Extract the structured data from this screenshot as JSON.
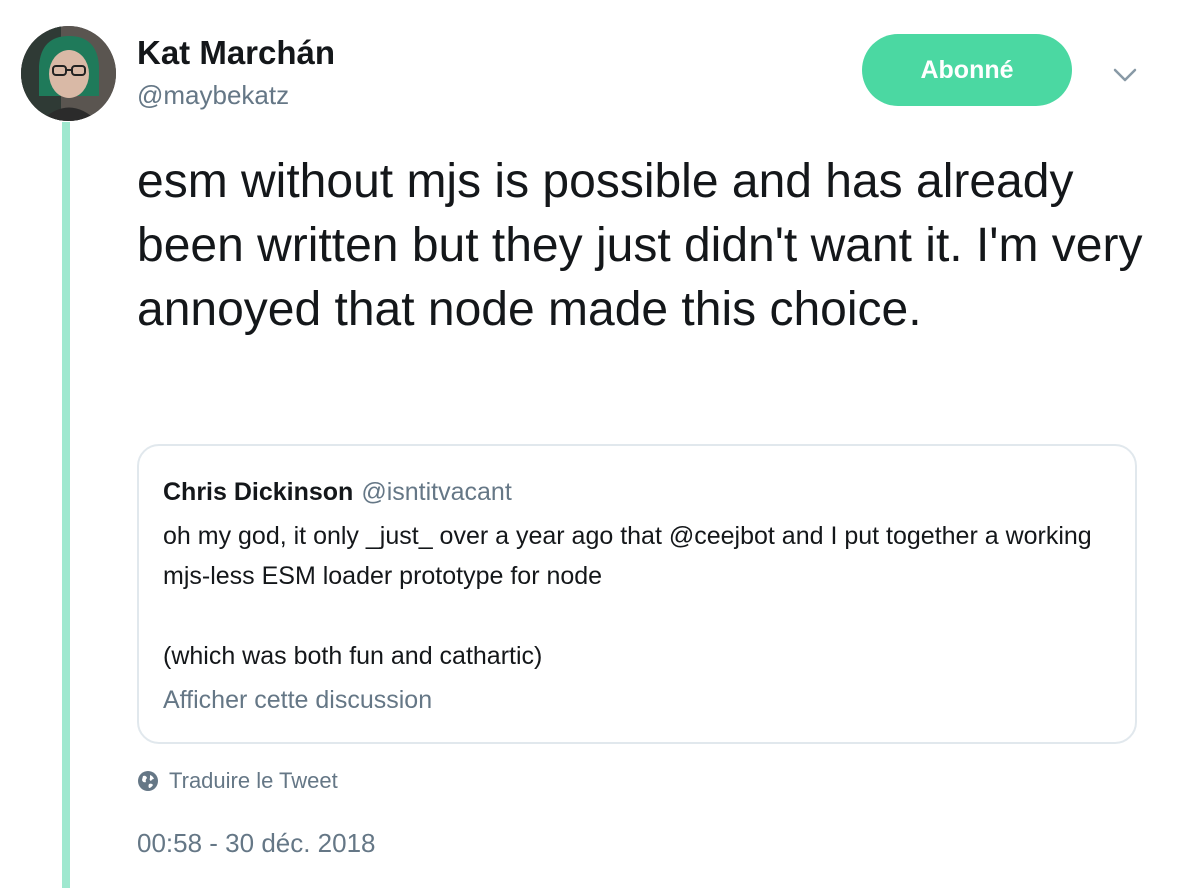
{
  "author": {
    "display_name": "Kat Marchán",
    "handle": "@maybekatz",
    "avatar_icon": "profile-photo"
  },
  "follow_button": {
    "label": "Abonné",
    "color": "#4bd8a2"
  },
  "menu": {
    "icon": "chevron-down-icon"
  },
  "tweet": {
    "text": "esm without mjs is possible and has already been written but they just didn't want it. I'm very annoyed that node made this choice."
  },
  "quoted_tweet": {
    "author_name": "Chris Dickinson",
    "author_handle": "@isntitvacant",
    "paragraphs": [
      "oh my god, it only _just_ over a year ago that @ceejbot and I put together a working mjs-less ESM loader prototype for node",
      "(which was both fun and cathartic)"
    ],
    "show_thread_label": "Afficher cette discussion"
  },
  "translate": {
    "label": "Traduire le Tweet",
    "icon": "globe-icon"
  },
  "timestamp": "00:58 - 30 déc. 2018",
  "colors": {
    "accent": "#4bd8a2",
    "thread_line": "#9fe8cf",
    "secondary_text": "#657786",
    "primary_text": "#14171a",
    "card_border": "#e1e8ed"
  }
}
